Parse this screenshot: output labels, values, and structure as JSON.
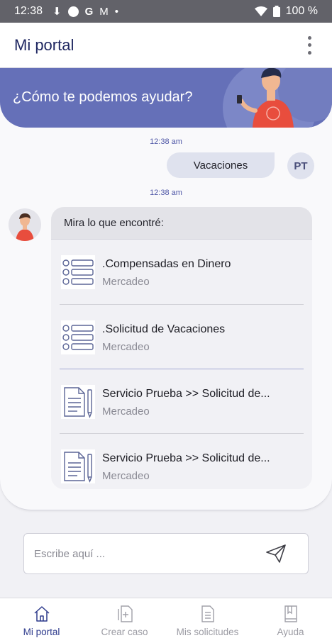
{
  "status_bar": {
    "time": "12:38",
    "battery": "100 %"
  },
  "app_bar": {
    "title": "Mi portal"
  },
  "banner": {
    "text": "¿Cómo te podemos ayudar?"
  },
  "conversation": {
    "user_timestamp": "12:38 am",
    "user_message": "Vacaciones",
    "user_initials": "PT",
    "bot_timestamp": "12:38 am",
    "bot_intro": "Mira lo que encontré:",
    "results": [
      {
        "title": ".Compensadas en Dinero",
        "subtitle": "Mercadeo",
        "icon": "list-icon"
      },
      {
        "title": ".Solicitud de Vacaciones",
        "subtitle": "Mercadeo",
        "icon": "list-icon"
      },
      {
        "title": "Servicio Prueba >> Solicitud de...",
        "subtitle": "Mercadeo",
        "icon": "document-icon"
      },
      {
        "title": "Servicio Prueba >> Solicitud de...",
        "subtitle": "Mercadeo",
        "icon": "document-icon"
      }
    ]
  },
  "composer": {
    "placeholder": "Escribe aquí ..."
  },
  "bottom_nav": {
    "active": "Mi portal",
    "items": [
      {
        "label": "Mi portal",
        "icon": "home-icon"
      },
      {
        "label": "Crear caso",
        "icon": "new-case-icon"
      },
      {
        "label": "Mis solicitudes",
        "icon": "requests-icon"
      },
      {
        "label": "Ayuda",
        "icon": "help-book-icon"
      }
    ]
  },
  "colors": {
    "primary": "#2d3a8c",
    "banner": "#6570b8",
    "accent_person": "#e84d3d"
  }
}
